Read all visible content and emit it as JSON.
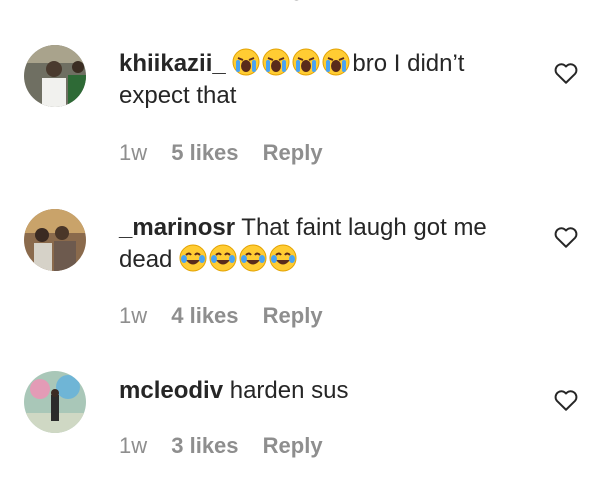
{
  "comments": [
    {
      "username": "khiikazii_",
      "text_line1": "bro I didn’t",
      "text_line2": "expect that",
      "emoji_count": 4,
      "emoji_icon": "loudly-crying-face-emoji",
      "time": "1w",
      "likes": "5 likes",
      "reply": "Reply"
    },
    {
      "username": "_marinosr",
      "text_line1": "That faint laugh got me",
      "text_line2": "dead",
      "emoji_count": 4,
      "emoji_icon": "tears-of-joy-emoji",
      "time": "1w",
      "likes": "4 likes",
      "reply": "Reply"
    },
    {
      "username": "mcleodiv",
      "text_line1": "harden sus",
      "time": "1w",
      "likes": "3 likes",
      "reply": "Reply"
    }
  ],
  "icons": {
    "like": "heart-outline-icon"
  },
  "colors": {
    "meta_text": "#8e8e8e",
    "primary_text": "#262626",
    "emoji_yellow": "#ffcc33",
    "tear_blue": "#4aa3f0"
  }
}
